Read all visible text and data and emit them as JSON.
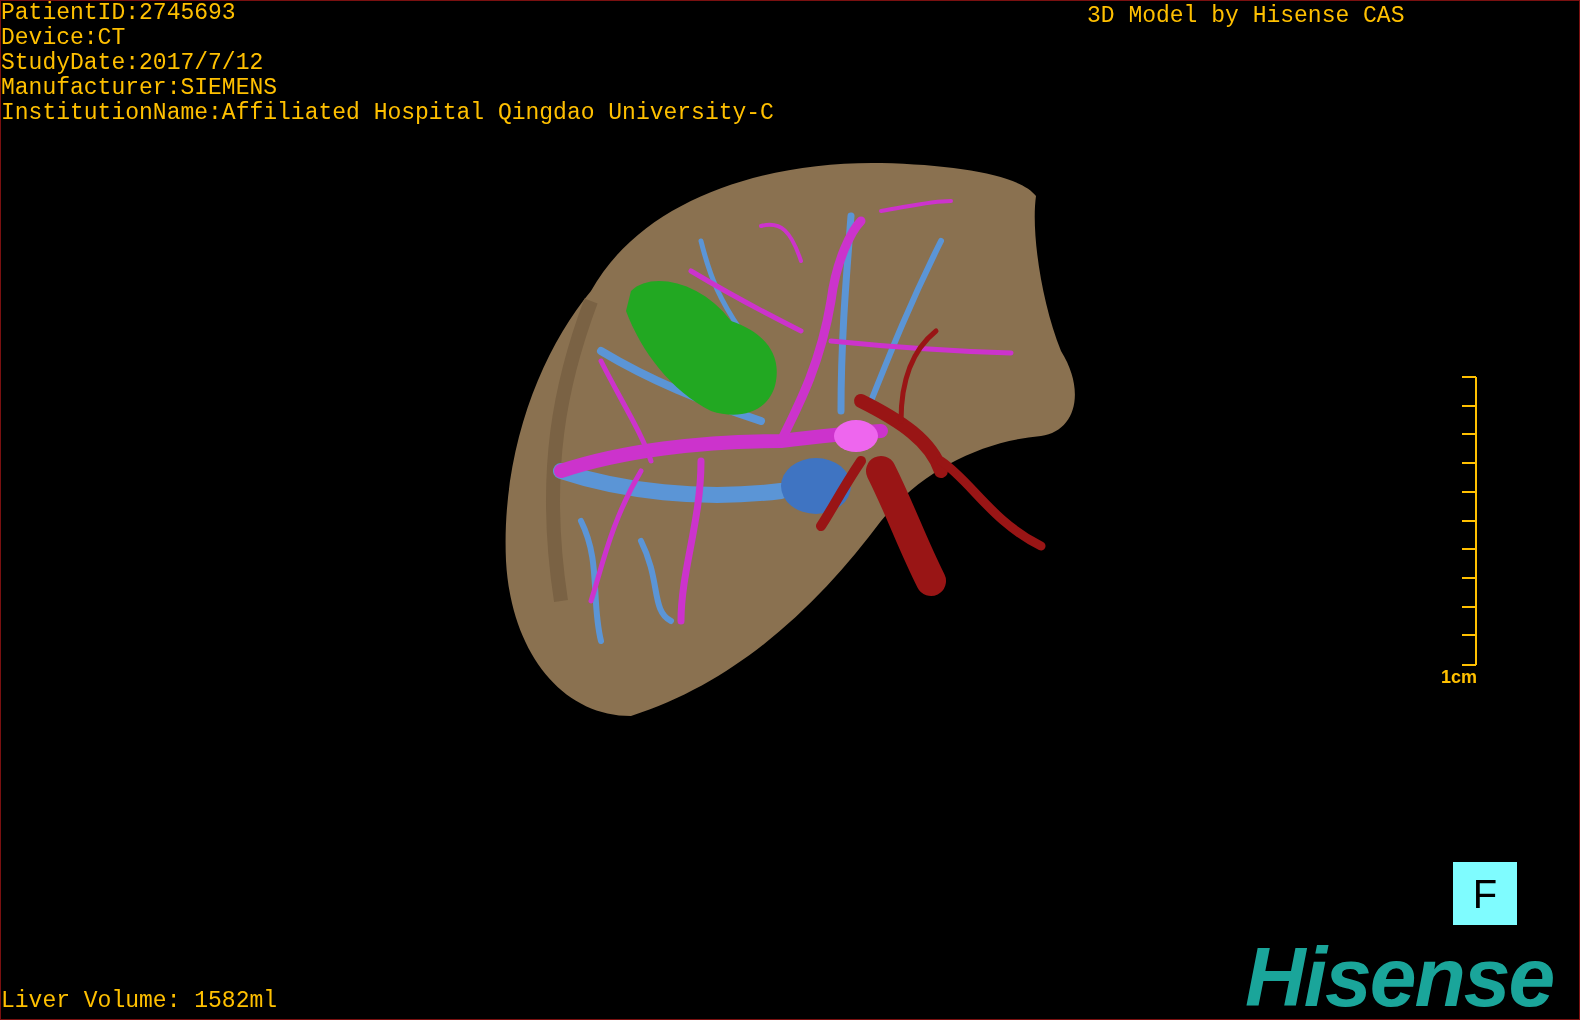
{
  "patient_info": [
    "PatientID:2745693",
    "Device:CT",
    "StudyDate:2017/7/12",
    "Manufacturer:SIEMENS",
    "InstitutionName:Affiliated Hospital Qingdao University-C"
  ],
  "title": "3D Model by Hisense CAS",
  "scale_bar": {
    "label": "1cm"
  },
  "orientation_label": "F",
  "liver_volume": "Liver Volume: 1582ml",
  "logo": "Hisense"
}
